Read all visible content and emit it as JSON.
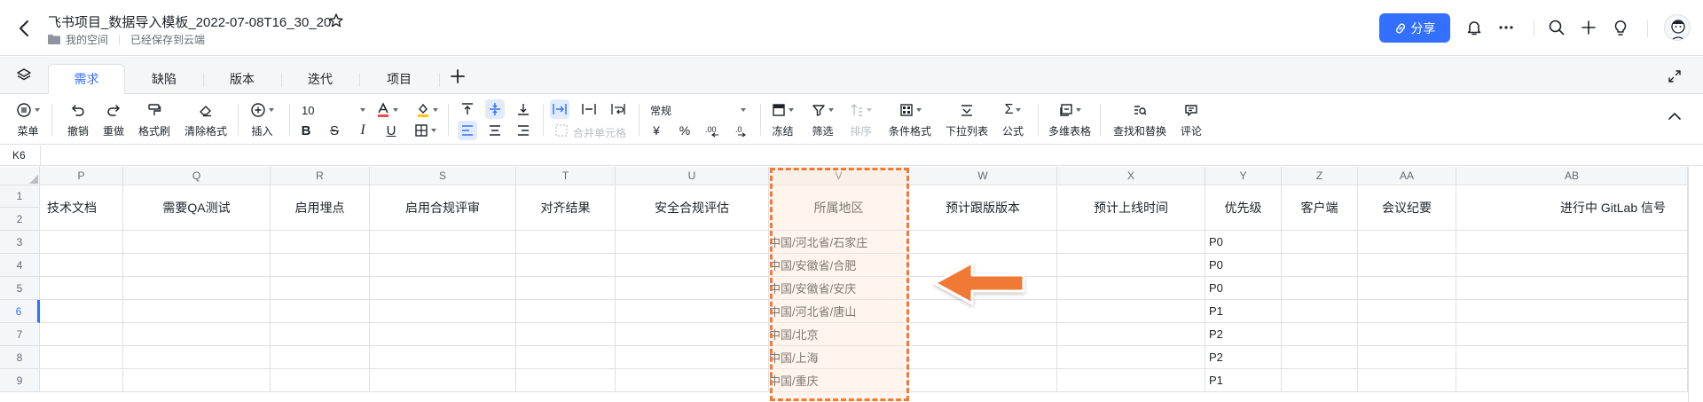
{
  "header": {
    "title": "飞书项目_数据导入模板_2022-07-08T16_30_20",
    "breadcrumb_space": "我的空间",
    "save_status": "已经保存到云端",
    "share_label": "分享"
  },
  "tabs": [
    "需求",
    "缺陷",
    "版本",
    "迭代",
    "项目"
  ],
  "toolbar": {
    "menu": "菜单",
    "undo": "撤销",
    "redo": "重做",
    "format_painter": "格式刷",
    "clear_format": "清除格式",
    "insert": "插入",
    "font_size": "10",
    "merge_cells": "合并单元格",
    "number_format": "常规",
    "freeze": "冻结",
    "filter": "筛选",
    "sort": "排序",
    "conditional_format": "条件格式",
    "dropdown_list": "下拉列表",
    "formula": "公式",
    "multi_dim_table": "多维表格",
    "find_replace": "查找和替换",
    "comment": "评论",
    "currency_symbol": "¥",
    "percent_symbol": "%"
  },
  "cell_ref": "K6",
  "grid": {
    "columns": [
      "P",
      "Q",
      "R",
      "S",
      "T",
      "U",
      "V",
      "W",
      "X",
      "Y",
      "Z",
      "AA",
      "AB"
    ],
    "headers": [
      "技术文档",
      "需要QA测试",
      "启用埋点",
      "启用合规评审",
      "对齐结果",
      "安全合规评估",
      "所属地区",
      "预计跟版版本",
      "预计上线时间",
      "优先级",
      "客户端",
      "会议纪要",
      "进行中 GitLab 信号"
    ],
    "row_numbers": [
      "1",
      "2",
      "3",
      "4",
      "5",
      "6",
      "7",
      "8",
      "9"
    ],
    "region_values": [
      "中国/河北省/石家庄",
      "中国/安徽省/合肥",
      "中国/安徽省/安庆",
      "中国/河北省/唐山",
      "中国/北京",
      "中国/上海",
      "中国/重庆"
    ],
    "priority_values": [
      "P0",
      "P0",
      "P0",
      "P1",
      "P2",
      "P2",
      "P1"
    ]
  },
  "colors": {
    "accent": "#3370ff",
    "highlight_border": "#f07a34",
    "arrow": "#f07a34"
  }
}
